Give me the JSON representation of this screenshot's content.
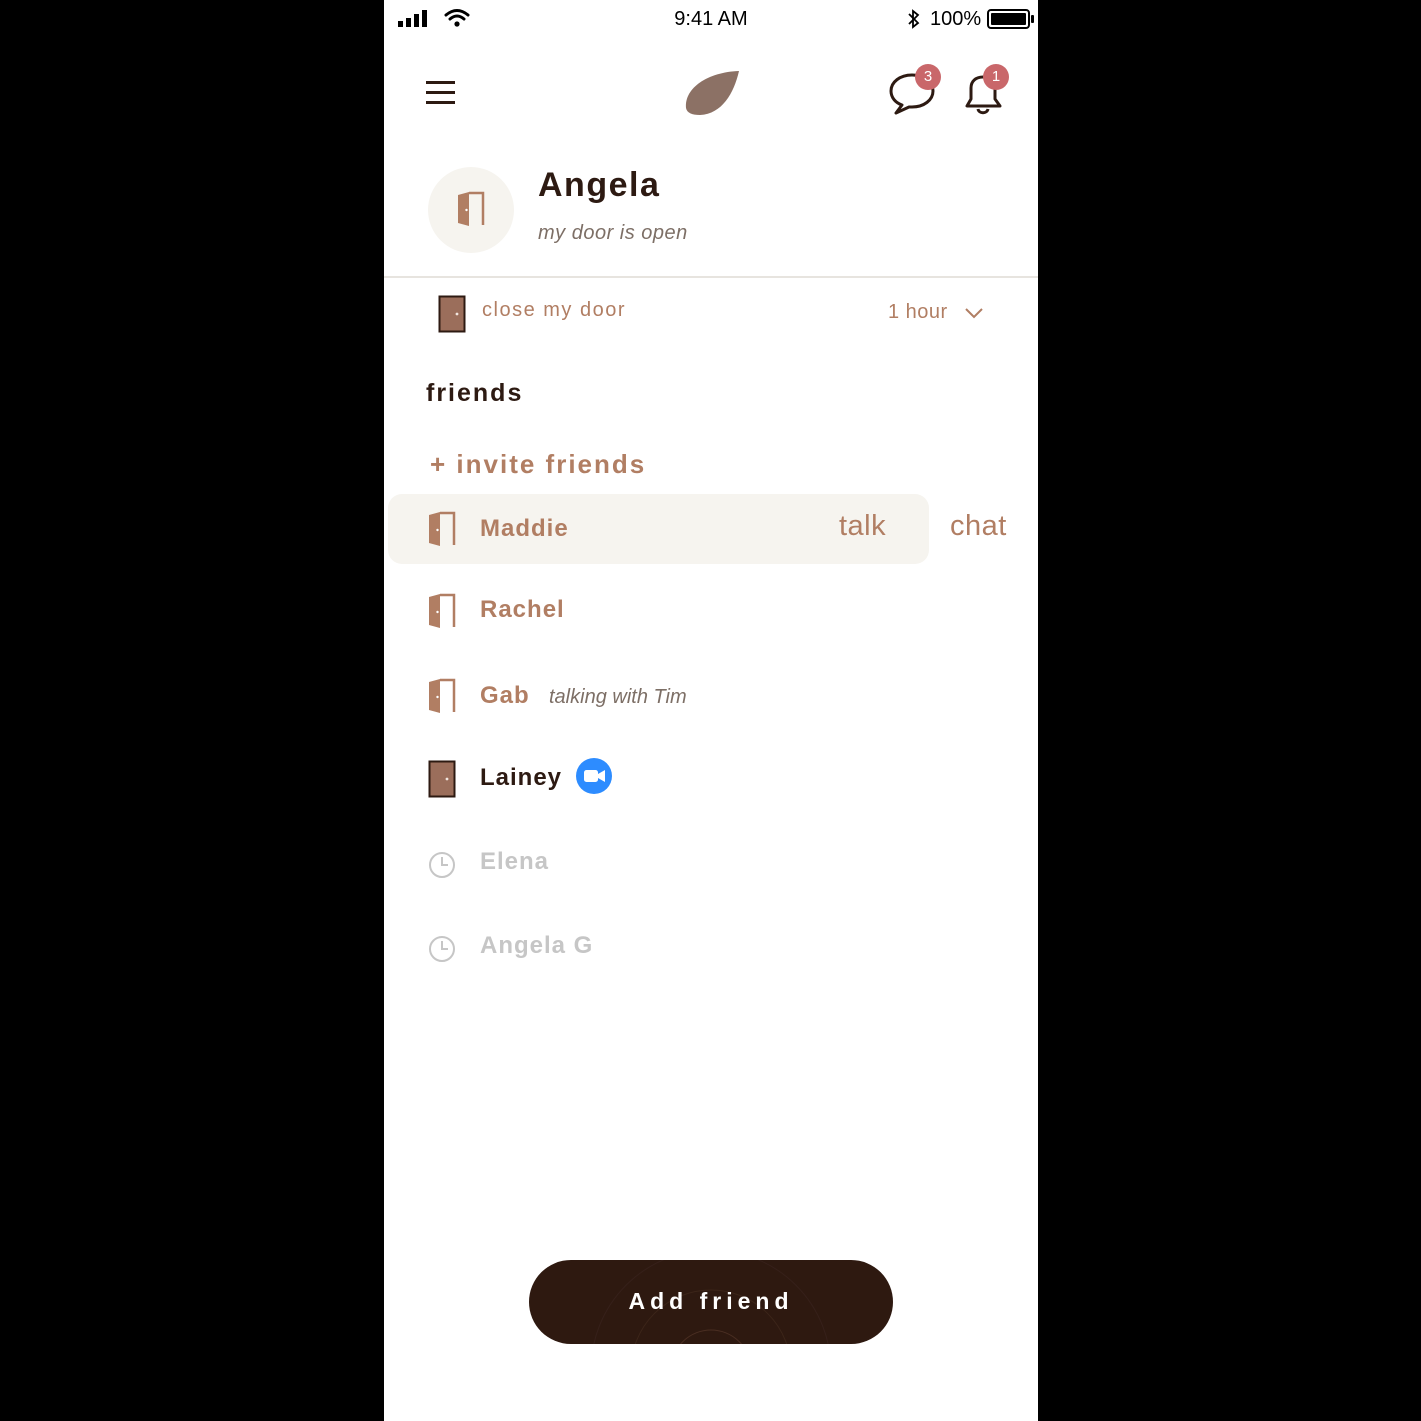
{
  "status_bar": {
    "time": "9:41 AM",
    "battery": "100%"
  },
  "header": {
    "menu_icon": "hamburger-menu-icon",
    "logo_icon": "leaf-logo-icon",
    "messages_badge": "3",
    "notifications_badge": "1"
  },
  "profile": {
    "name": "Angela",
    "status": "my door is open"
  },
  "door_control": {
    "label": "close my door",
    "duration": "1 hour"
  },
  "friends": {
    "title": "friends",
    "invite_label": "+ invite friends",
    "items": [
      {
        "name": "Maddie",
        "state": "open",
        "talk_label": "talk",
        "chat_label": "chat"
      },
      {
        "name": "Rachel",
        "state": "open"
      },
      {
        "name": "Gab",
        "state": "open",
        "activity": "talking with Tim"
      },
      {
        "name": "Lainey",
        "state": "closed",
        "icon": "video-call-icon"
      },
      {
        "name": "Elena",
        "state": "pending"
      },
      {
        "name": "Angela G",
        "state": "pending"
      }
    ]
  },
  "add_button": {
    "label": "Add friend"
  },
  "colors": {
    "accent": "#b17e63",
    "dark": "#2d1a12",
    "badge": "#c9676a",
    "highlight": "#f6f4ef",
    "video": "#2d8cff"
  }
}
